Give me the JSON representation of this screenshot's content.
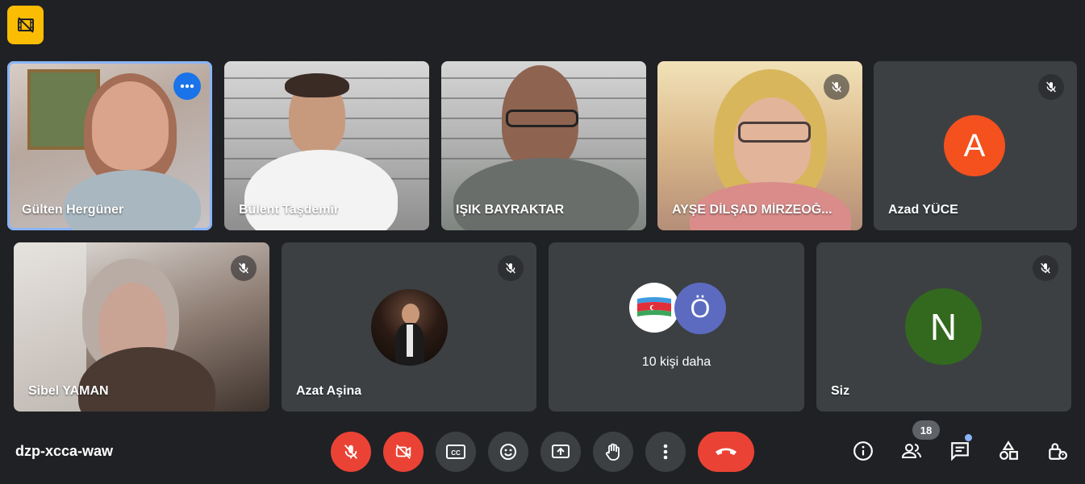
{
  "meeting": {
    "code": "dzp-xcca-waw"
  },
  "participants": [
    {
      "name": "Gülten Hergüner",
      "type": "video",
      "muted": false,
      "active": true
    },
    {
      "name": "Bülent Taşdemir",
      "type": "video",
      "muted": false
    },
    {
      "name": "IŞIK BAYRAKTAR",
      "type": "video",
      "muted": false
    },
    {
      "name": "AYŞE DİLŞAD MİRZEOĞ...",
      "type": "video",
      "muted": true
    },
    {
      "name": "Azad YÜCE",
      "type": "avatar",
      "initial": "A",
      "avatar_color": "#f4511e",
      "muted": true
    },
    {
      "name": "Sibel YAMAN",
      "type": "video",
      "muted": true
    },
    {
      "name": "Azat Aşina",
      "type": "photo-avatar",
      "muted": true
    },
    {
      "name": "Siz",
      "type": "avatar",
      "initial": "N",
      "avatar_color": "#33691e",
      "muted": true
    }
  ],
  "others_tile": {
    "label": "10 kişi daha",
    "avatar_initial": "Ö",
    "avatar_color": "#5c6bc0"
  },
  "controls": {
    "mic": "mic-off-icon",
    "camera": "camera-off-icon",
    "captions": "CC",
    "people_count": "18"
  },
  "colors": {
    "background": "#202124",
    "tile": "#3c4043",
    "accent": "#8ab4f8",
    "danger": "#ea4335"
  }
}
